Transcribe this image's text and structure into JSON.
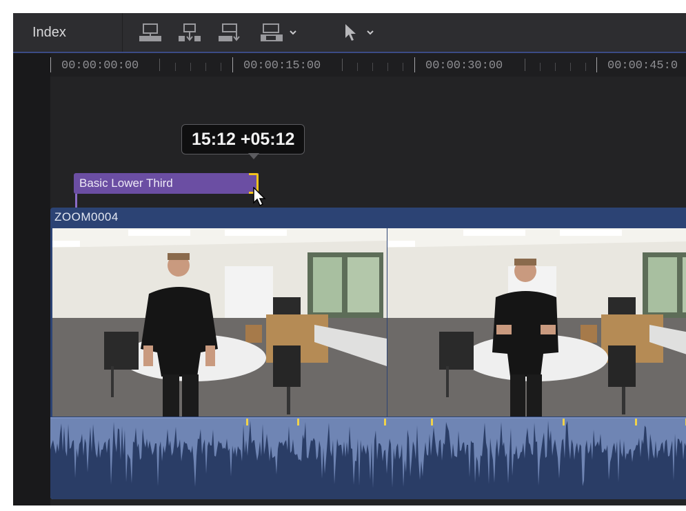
{
  "toolbar": {
    "index_label": "Index",
    "tools": [
      {
        "icon": "connect-clip-icon"
      },
      {
        "icon": "insert-clip-icon"
      },
      {
        "icon": "append-clip-icon"
      },
      {
        "icon": "overwrite-clip-icon",
        "has_menu": true
      },
      {
        "icon": "select-tool-icon",
        "has_menu": true
      }
    ],
    "accent_color": "#3b4b86"
  },
  "ruler": {
    "timecodes": [
      "00:00:00:00",
      "00:00:15:00",
      "00:00:30:00",
      "00:00:45:0"
    ]
  },
  "tooltip": {
    "text": "15:12  +05:12"
  },
  "title_clip": {
    "label": "Basic Lower Third",
    "color": "#6b4ea3",
    "trim_color": "#f2c31b"
  },
  "video_clip": {
    "name": "ZOOM0004",
    "color": "#2c4374"
  }
}
